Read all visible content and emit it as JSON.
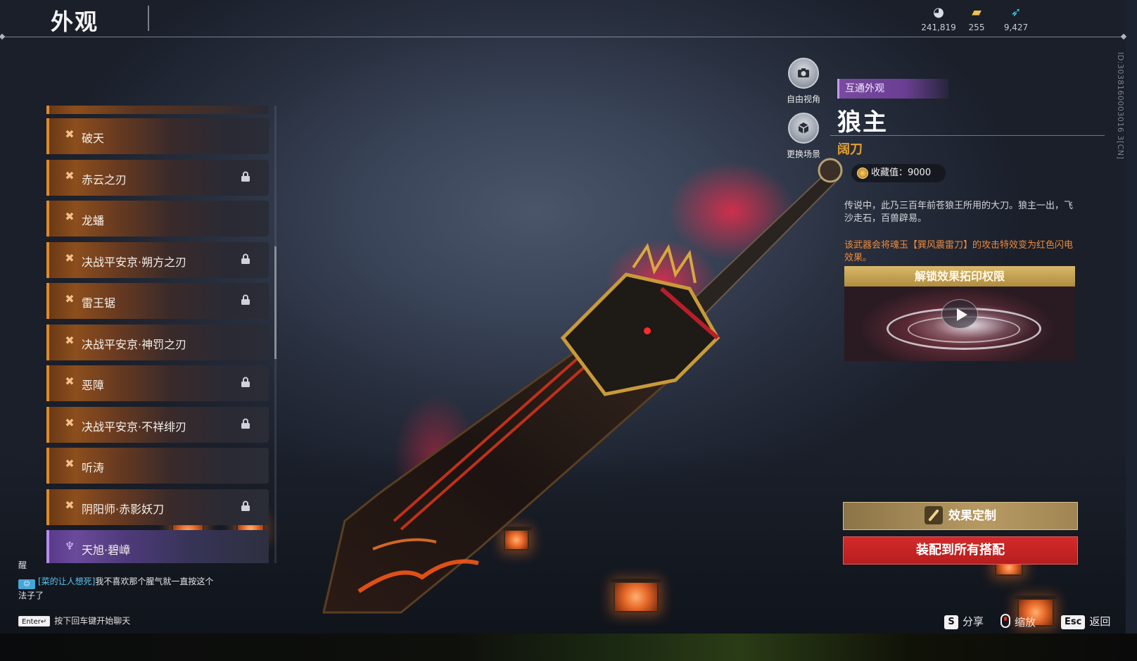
{
  "header": {
    "title": "外观"
  },
  "currencies": [
    {
      "icon": "gem-currency-icon",
      "value": "241,819"
    },
    {
      "icon": "ticket-currency-icon",
      "value": "255"
    },
    {
      "icon": "feather-currency-icon",
      "value": "9,427"
    }
  ],
  "build_id": "ID:3038160003016 3[CN]",
  "skin_list": {
    "items": [
      {
        "label": "破天",
        "locked": false,
        "rarity": "orange"
      },
      {
        "label": "赤云之刃",
        "locked": true,
        "rarity": "orange"
      },
      {
        "label": "龙蟠",
        "locked": false,
        "rarity": "orange"
      },
      {
        "label": "决战平安京·朔方之刃",
        "locked": true,
        "rarity": "orange"
      },
      {
        "label": "雷王锯",
        "locked": true,
        "rarity": "orange"
      },
      {
        "label": "决战平安京·神罚之刃",
        "locked": false,
        "rarity": "orange"
      },
      {
        "label": "恶障",
        "locked": true,
        "rarity": "orange"
      },
      {
        "label": "决战平安京·不祥绯刃",
        "locked": true,
        "rarity": "orange"
      },
      {
        "label": "听涛",
        "locked": false,
        "rarity": "orange"
      },
      {
        "label": "阴阳师·赤影妖刀",
        "locked": true,
        "rarity": "orange"
      },
      {
        "label": "天旭·碧嶂",
        "locked": false,
        "rarity": "purple"
      }
    ]
  },
  "chat": {
    "line1": "醒",
    "name": "[菜的让人想死]",
    "message": "我不喜欢那个腥气就一直按这个法子了",
    "hint_key": "Enter↵",
    "hint_text": "按下回车键开始聊天"
  },
  "camera": {
    "free_view_label": "自由视角",
    "change_scene_label": "更换场景"
  },
  "detail": {
    "share_tag": "互通外观",
    "name": "狼主",
    "type": "阔刀",
    "collect_value": "收藏值：9000",
    "description": "传说中，此乃三百年前苍狼王所用的大刀。狼主一出，飞沙走石，百兽辟易。",
    "effect": "该武器会将魂玉【巽风震雷刀】的攻击特效变为红色闪电效果。",
    "unlock_title": "解锁效果拓印权限"
  },
  "actions": {
    "customize_label": "效果定制",
    "equip_all_label": "装配到所有搭配"
  },
  "footer": {
    "share_key": "S",
    "share_label": "分享",
    "zoom_label": "缩放",
    "back_key": "Esc",
    "back_label": "返回"
  },
  "colors": {
    "accent_orange": "#e5a032",
    "rarity_orange": "#e08a2a",
    "rarity_purple": "#b58cf0",
    "equip_red": "#c92424",
    "effect_text": "#ef8a3a"
  }
}
